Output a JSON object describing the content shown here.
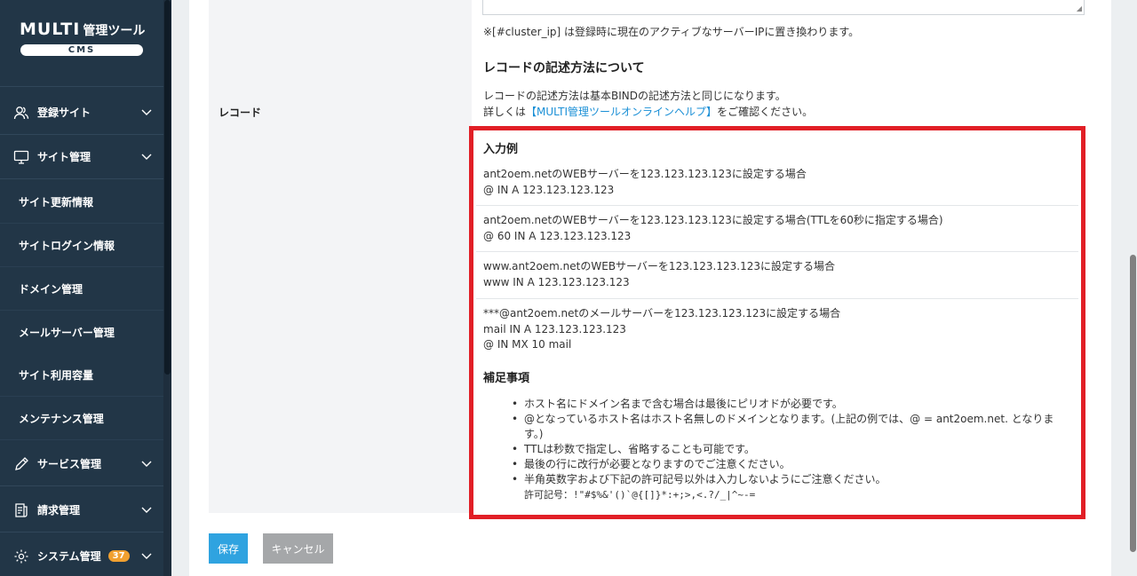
{
  "logo": {
    "title": "MULTI",
    "title_sub": "管理ツール",
    "cms": "CMS"
  },
  "nav": {
    "sites": "登録サイト",
    "site_manage": "サイト管理",
    "sub": [
      "サイト更新情報",
      "サイトログイン情報",
      "ドメイン管理",
      "メールサーバー管理",
      "サイト利用容量",
      "メンテナンス管理"
    ],
    "service": "サービス管理",
    "billing": "請求管理",
    "system": "システム管理",
    "system_badge": "37"
  },
  "form": {
    "row_label": "レコード",
    "note": "※[#cluster_ip] は登録時に現在のアクティブなサーバーIPに置き換わります。",
    "section_title": "レコードの記述方法について",
    "desc1": "レコードの記述方法は基本BINDの記述方法と同じになります。",
    "desc2_prefix": "詳しくは",
    "desc2_link": "【MULTI管理ツールオンラインヘルプ】",
    "desc2_suffix": "をご確認ください。"
  },
  "examples": {
    "title": "入力例",
    "items": [
      {
        "desc": "ant2oem.netのWEBサーバーを123.123.123.123に設定する場合",
        "lines": [
          "@ IN A 123.123.123.123"
        ]
      },
      {
        "desc": "ant2oem.netのWEBサーバーを123.123.123.123に設定する場合(TTLを60秒に指定する場合)",
        "lines": [
          "@ 60 IN A 123.123.123.123"
        ]
      },
      {
        "desc": "www.ant2oem.netのWEBサーバーを123.123.123.123に設定する場合",
        "lines": [
          "www IN A 123.123.123.123"
        ]
      },
      {
        "desc": "***@ant2oem.netのメールサーバーを123.123.123.123に設定する場合",
        "lines": [
          "mail IN A 123.123.123.123",
          "@ IN MX 10 mail"
        ]
      }
    ]
  },
  "supplement": {
    "title": "補足事項",
    "items": [
      "ホスト名にドメイン名まで含む場合は最後にピリオドが必要です。",
      "@となっているホスト名はホスト名無しのドメインとなります。(上記の例では、@ = ant2oem.net. となります。)",
      "TTLは秒数で指定し、省略することも可能です。",
      "最後の行に改行が必要となりますのでご注意ください。",
      "半角英数字および下記の許可記号以外は入力しないようにご注意ください。"
    ],
    "allowed": "許可記号：!\"#$%&'()`@{[]}*:+;>,<.?/_|^~-="
  },
  "buttons": {
    "save": "保存",
    "cancel": "キャンセル"
  },
  "colors": {
    "sidebar": "#223647",
    "accent": "#2fa3e0",
    "highlight": "#e11f26",
    "badge": "#f0a030"
  }
}
